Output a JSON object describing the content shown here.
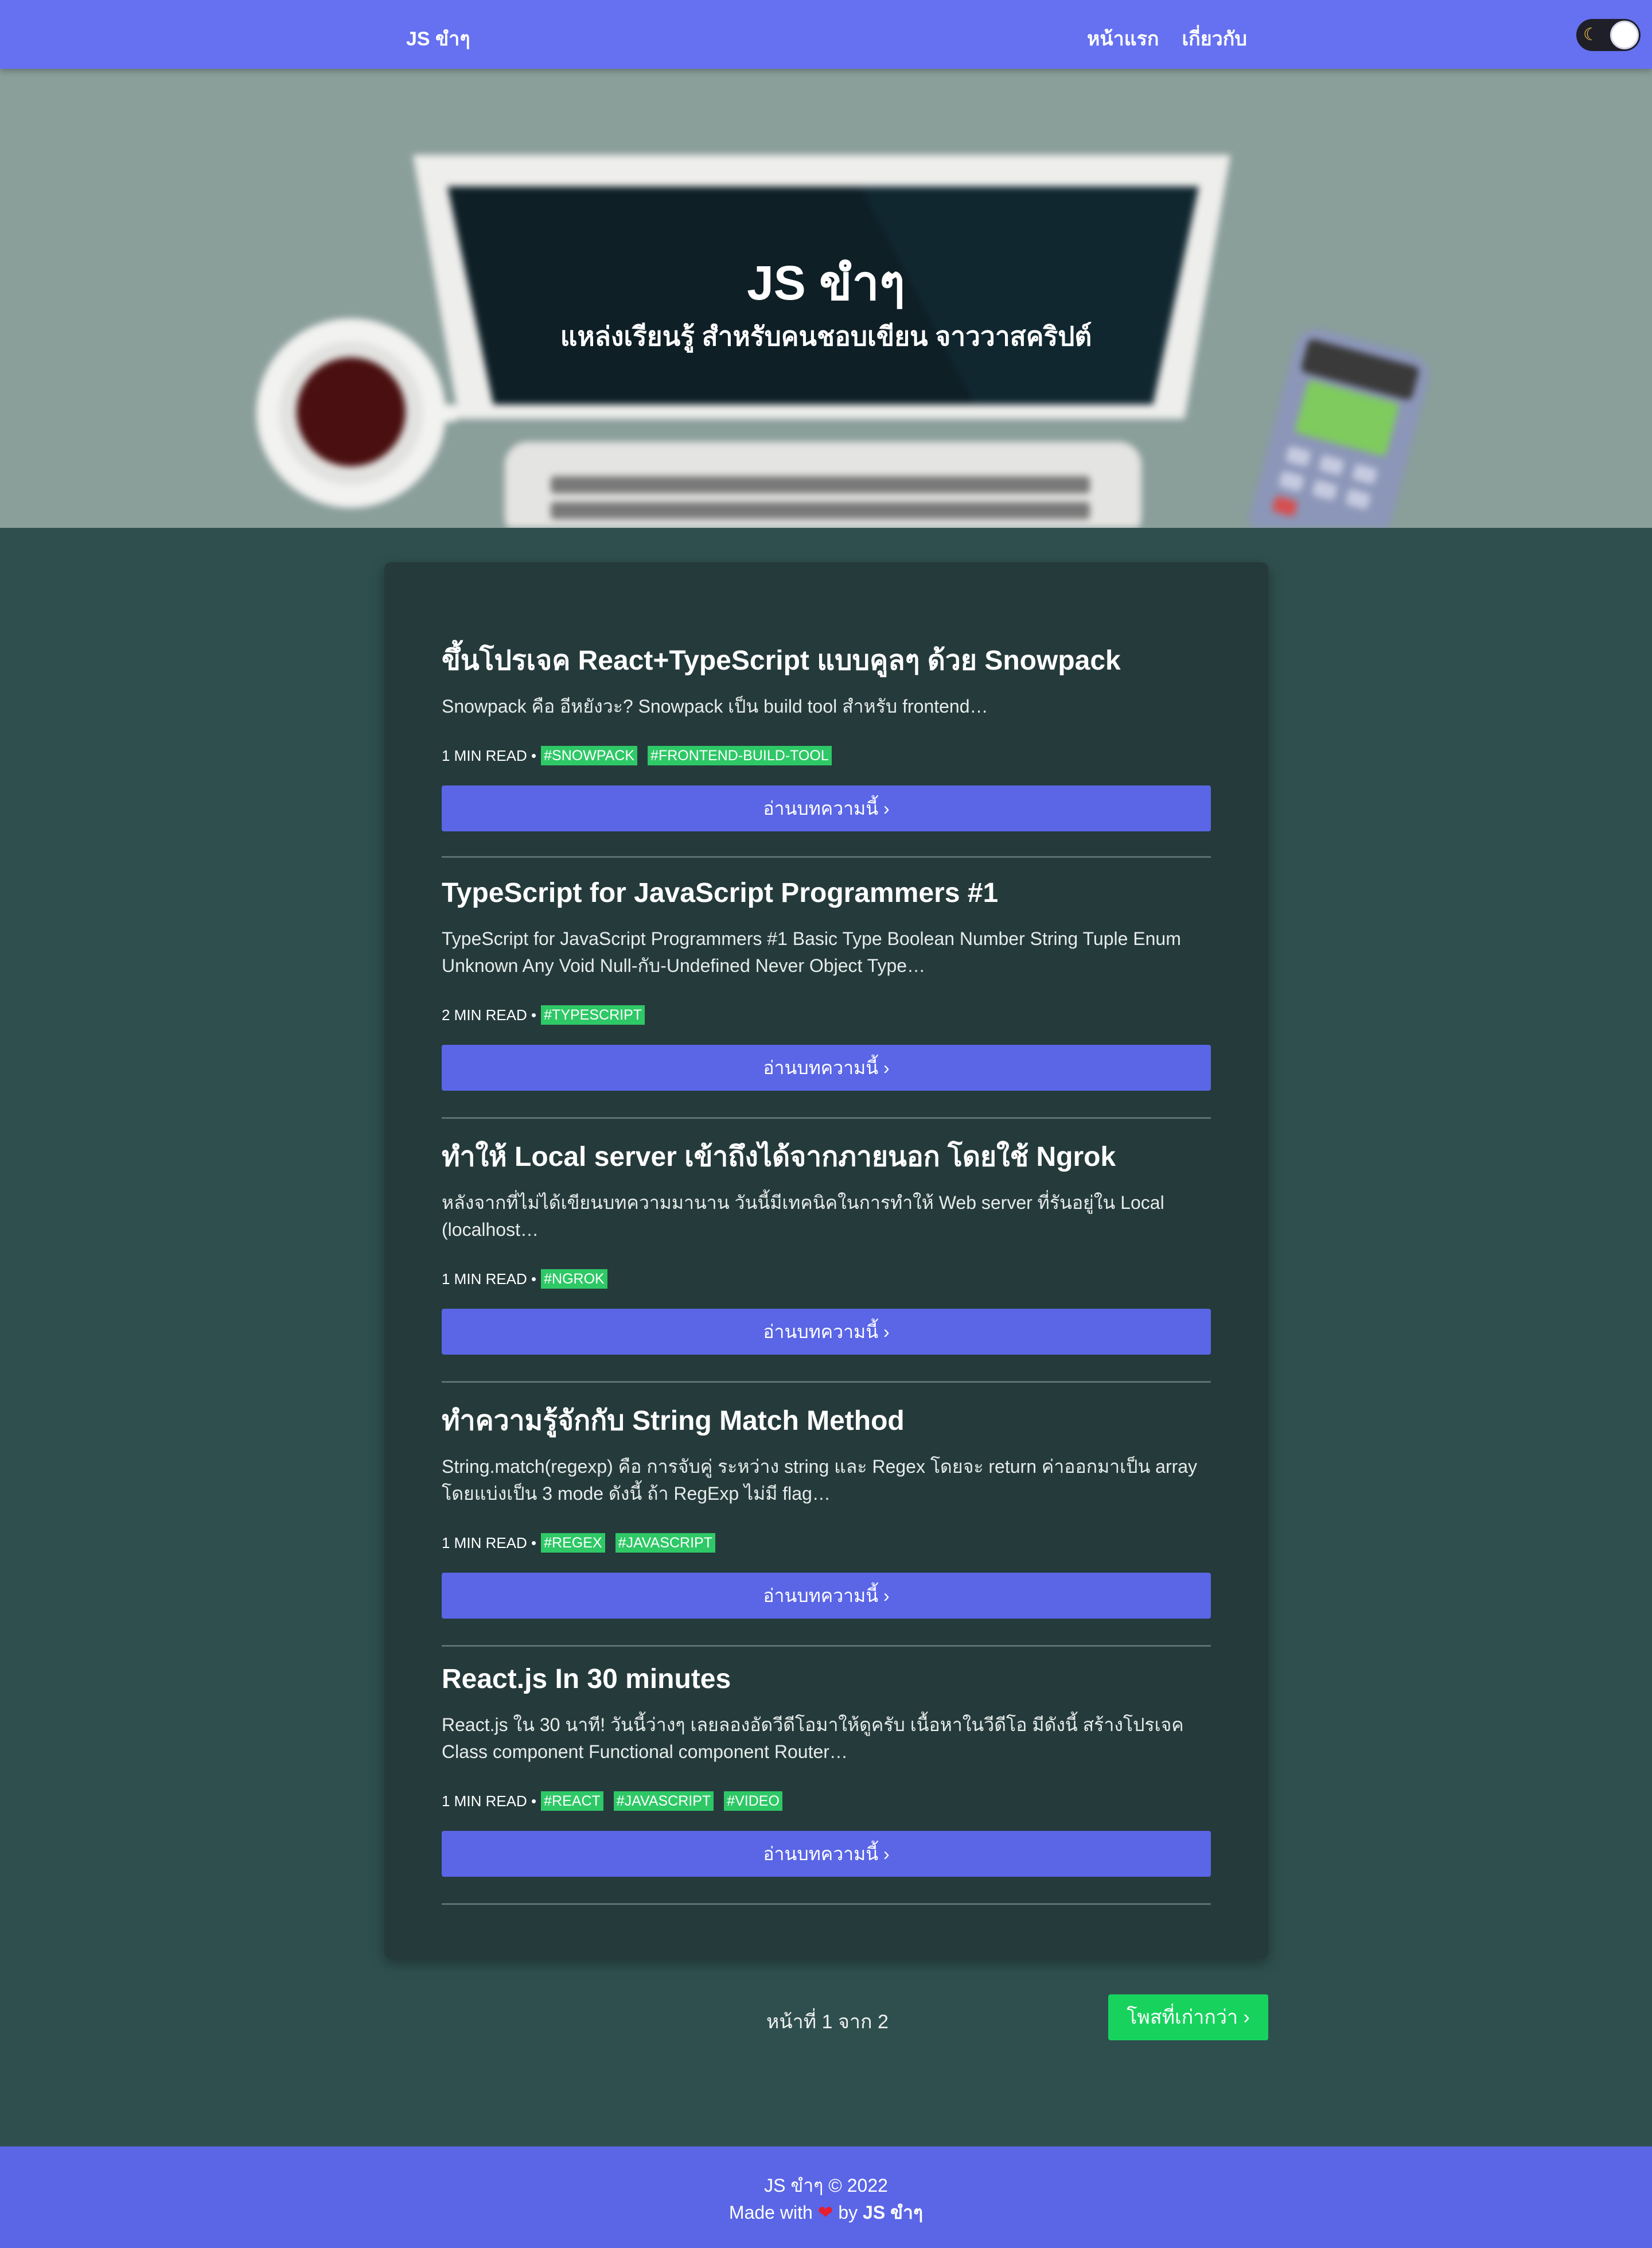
{
  "nav": {
    "brand": "JS ขำๆ",
    "links": [
      "หน้าแรก",
      "เกี่ยวกับ"
    ],
    "dark_mode_icon": "moon-icon"
  },
  "hero": {
    "title": "JS ขำๆ",
    "subtitle": "แหล่งเรียนรู้ สำหรับคนชอบเขียน จาววาสคริปต์"
  },
  "posts": [
    {
      "title": "ขึ้นโปรเจค React+TypeScript แบบคูลๆ ด้วย Snowpack",
      "excerpt": "Snowpack คือ อีหยังวะ? Snowpack เป็น build tool สำหรับ frontend…",
      "read_time": "1 MIN READ •",
      "tags": [
        "#SNOWPACK",
        "#FRONTEND-BUILD-TOOL"
      ],
      "button": "อ่านบทความนี้ ›"
    },
    {
      "title": "TypeScript for JavaScript Programmers #1",
      "excerpt": "TypeScript for JavaScript Programmers #1 Basic Type Boolean Number String Tuple Enum Unknown Any Void Null-กับ-Undefined Never Object Type…",
      "read_time": "2 MIN READ •",
      "tags": [
        "#TYPESCRIPT"
      ],
      "button": "อ่านบทความนี้ ›"
    },
    {
      "title": "ทำให้ Local server เข้าถึงได้จากภายนอก โดยใช้ Ngrok",
      "excerpt": "หลังจากที่ไม่ได้เขียนบทความมานาน วันนี้มีเทคนิคในการทำให้ Web server ที่รันอยู่ใน Local (localhost…",
      "read_time": "1 MIN READ •",
      "tags": [
        "#NGROK"
      ],
      "button": "อ่านบทความนี้ ›"
    },
    {
      "title": "ทำความรู้จักกับ String Match Method",
      "excerpt": "String.match(regexp) คือ การจับคู่ ระหว่าง string และ Regex โดยจะ return ค่าออกมาเป็น array โดยแบ่งเป็น 3 mode ดังนี้ ถ้า RegExp ไม่มี flag…",
      "read_time": "1 MIN READ •",
      "tags": [
        "#REGEX",
        "#JAVASCRIPT"
      ],
      "button": "อ่านบทความนี้ ›"
    },
    {
      "title": "React.js In 30 minutes",
      "excerpt": "React.js ใน 30 นาที! วันนี้ว่างๆ เลยลองอัดวีดีโอมาให้ดูครับ เนื้อหาในวีดีโอ มีดังนี้ สร้างโปรเจค Class component Functional component Router…",
      "read_time": "1 MIN READ •",
      "tags": [
        "#REACT",
        "#JAVASCRIPT",
        "#VIDEO"
      ],
      "button": "อ่านบทความนี้ ›"
    }
  ],
  "pagination": {
    "info": "หน้าที่ 1 จาก 2",
    "older_button": "โพสที่เก่ากว่า ›"
  },
  "footer": {
    "copyright": "JS ขำๆ © 2022",
    "made_with": "Made with",
    "by": "by",
    "author": "JS ขำๆ",
    "heart": "❤"
  },
  "colors": {
    "nav": "#6571f0",
    "accent": "#5a66e6",
    "page_bg": "#2f4f4f",
    "card_bg": "#253a3b",
    "tag": "#2ec866",
    "older_button": "#17d35e"
  }
}
